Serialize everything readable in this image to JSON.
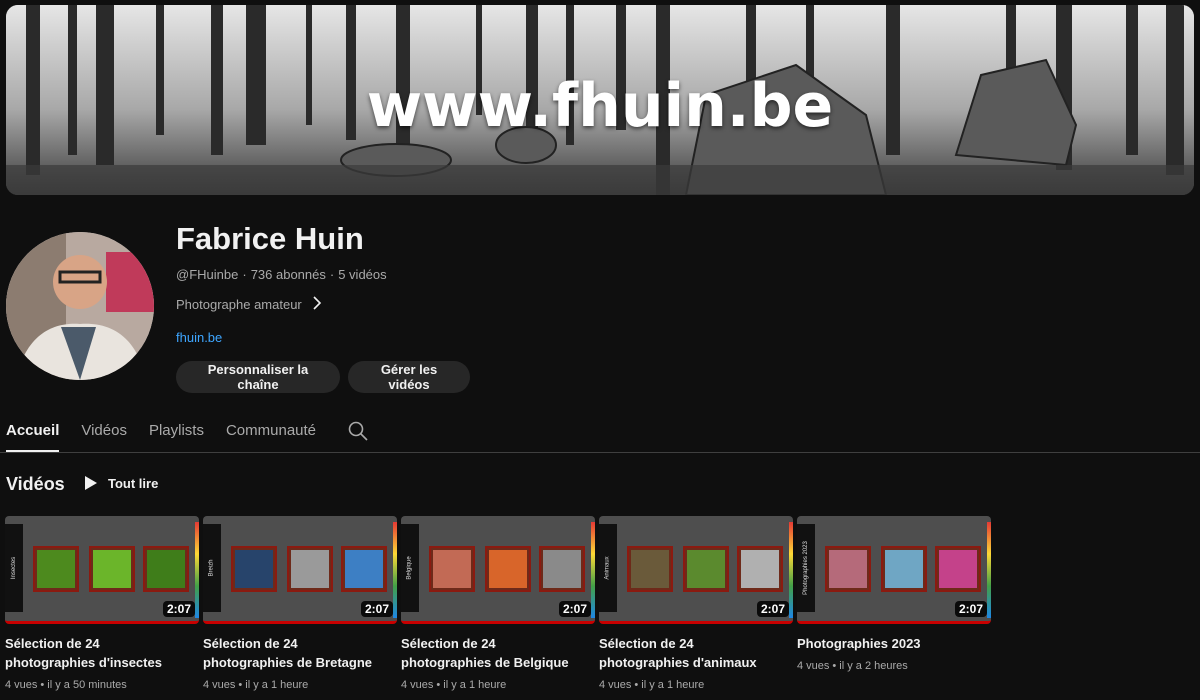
{
  "banner": {
    "text": "www.fhuin.be"
  },
  "channel": {
    "name": "Fabrice Huin",
    "handle": "@FHuinbe",
    "subscribers": "736 abonnés",
    "video_count": "5 vidéos",
    "description": "Photographe amateur",
    "link": "fhuin.be",
    "customize_label": "Personnaliser la chaîne",
    "manage_label": "Gérer les vidéos"
  },
  "tabs": [
    {
      "label": "Accueil",
      "active": true
    },
    {
      "label": "Vidéos",
      "active": false
    },
    {
      "label": "Playlists",
      "active": false
    },
    {
      "label": "Communauté",
      "active": false
    }
  ],
  "section": {
    "title": "Vidéos",
    "play_all": "Tout lire"
  },
  "videos": [
    {
      "side_label": "Insectes",
      "duration": "2:07",
      "title_line1": "Sélection de 24",
      "title_line2": "photographies d'insectes",
      "views": "4 vues",
      "age": "il y a 50 minutes",
      "photo_colors": [
        "#4d8a1e",
        "#6bb52a",
        "#3f7d1a"
      ]
    },
    {
      "side_label": "Breizh",
      "duration": "2:07",
      "title_line1": "Sélection de 24",
      "title_line2": "photographies de Bretagne",
      "views": "4 vues",
      "age": "il y a 1 heure",
      "photo_colors": [
        "#27446b",
        "#9a9a9a",
        "#3d7fc4"
      ]
    },
    {
      "side_label": "Belgique",
      "duration": "2:07",
      "title_line1": "Sélection de 24",
      "title_line2": "photographies de Belgique",
      "views": "4 vues",
      "age": "il y a 1 heure",
      "photo_colors": [
        "#c26a55",
        "#d8652a",
        "#8a8a8a"
      ]
    },
    {
      "side_label": "Animaux",
      "duration": "2:07",
      "title_line1": "Sélection de 24",
      "title_line2": "photographies d'animaux",
      "views": "4 vues",
      "age": "il y a 1 heure",
      "photo_colors": [
        "#6a5a3a",
        "#5b8a2e",
        "#b0b0b0"
      ]
    },
    {
      "side_label": "Photographies 2023",
      "duration": "2:07",
      "title_line1": "Photographies 2023",
      "title_line2": "",
      "views": "4 vues",
      "age": "il y a 2 heures",
      "photo_colors": [
        "#b56a7a",
        "#6fa6c4",
        "#c4428a"
      ]
    }
  ]
}
